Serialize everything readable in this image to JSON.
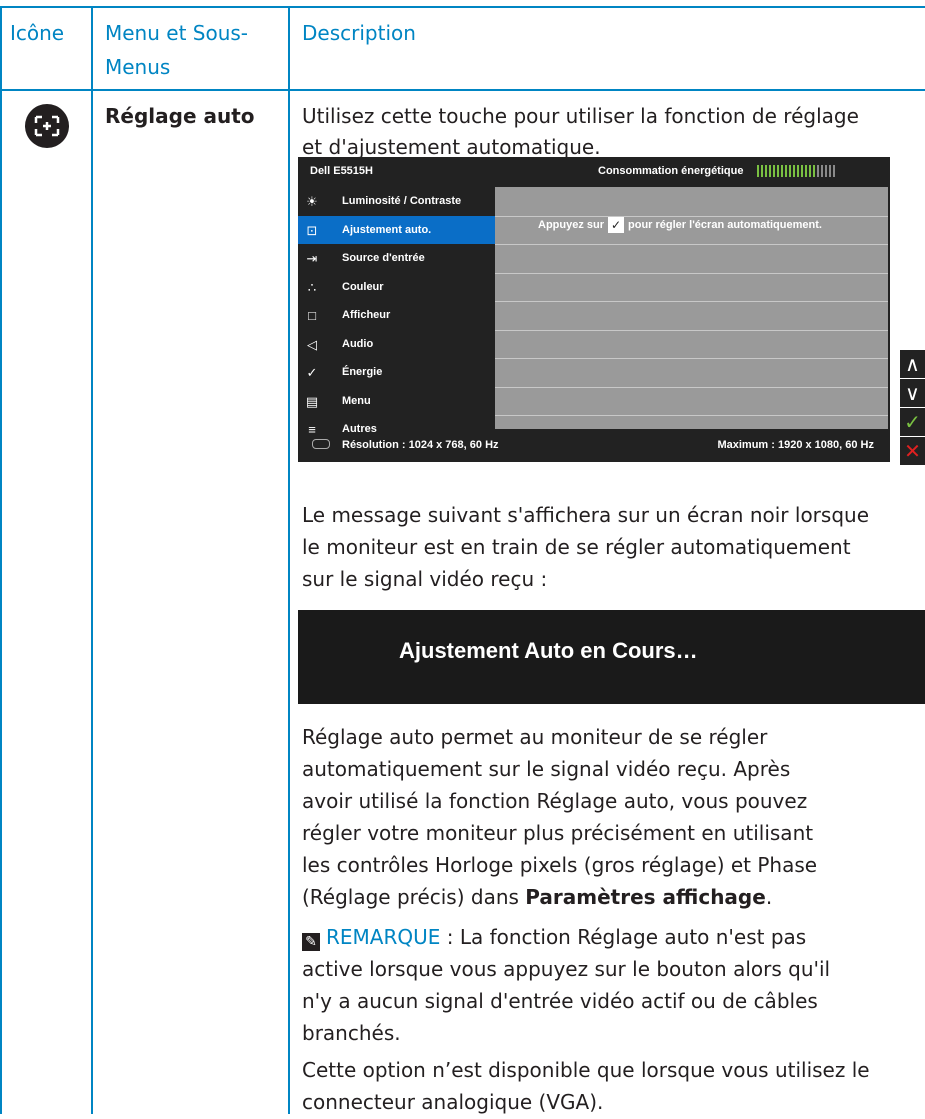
{
  "header": {
    "col1": "Icône",
    "col2a": "Menu et Sous-",
    "col2b": "Menus",
    "col3": "Description"
  },
  "row": {
    "icon_name": "auto-adjust-icon",
    "menu_label": "Réglage auto",
    "intro_line1": "Utilisez cette touche pour utiliser la fonction de réglage",
    "intro_line2": "et d'ajustement automatique.",
    "message_line1": "Le message suivant s'affichera sur un écran noir lorsque",
    "message_line2": "le moniteur est en train de se régler automatiquement",
    "message_line3": "sur le signal vidéo reçu :",
    "message_box_text": "Ajustement Auto en Cours…",
    "para_line1": "Réglage auto permet au moniteur de se régler",
    "para_line2": "automatiquement sur le signal vidéo reçu. Après",
    "para_line3": "avoir utilisé la fonction Réglage auto, vous pouvez",
    "para_line4": "régler votre moniteur plus précisément en utilisant",
    "para_line5": "les contrôles Horloge pixels (gros réglage) et Phase",
    "para_line6_pre": "(Réglage précis) dans ",
    "para_line6_bold": "Paramètres affichage",
    "para_line6_post": ".",
    "note_label": "REMARQUE",
    "note_line1_rest": " : La fonction Réglage auto n'est pas",
    "note_line2": "active lorsque vous appuyez sur le bouton alors qu'il",
    "note_line3": "n'y a aucun signal d'entrée vidéo actif ou de câbles",
    "note_line4": "branchés.",
    "vga_line1": "Cette option n’est disponible que lorsque vous utilisez le",
    "vga_line2": "connecteur analogique (VGA)."
  },
  "osd": {
    "model": "Dell E5515H",
    "energy_label": "Consommation énergétique",
    "energy_level_fraction": 0.75,
    "menu_items": [
      {
        "label": "Luminosité / Contraste",
        "icon": "brightness-icon",
        "glyph": "☀"
      },
      {
        "label": "Ajustement auto.",
        "icon": "auto-adjust-icon",
        "glyph": "⊡"
      },
      {
        "label": "Source d'entrée",
        "icon": "input-source-icon",
        "glyph": "⇥"
      },
      {
        "label": "Couleur",
        "icon": "color-icon",
        "glyph": "∴"
      },
      {
        "label": "Afficheur",
        "icon": "display-icon",
        "glyph": "□"
      },
      {
        "label": "Audio",
        "icon": "speaker-icon",
        "glyph": "◁"
      },
      {
        "label": "Énergie",
        "icon": "energy-leaf-icon",
        "glyph": "✓"
      },
      {
        "label": "Menu",
        "icon": "menu-icon",
        "glyph": "▤"
      },
      {
        "label": "Autres",
        "icon": "others-icon",
        "glyph": "≡"
      }
    ],
    "selected_index": 1,
    "panel_msg_pre": "Appuyez sur",
    "panel_msg_post": "pour régler l'écran automatiquement.",
    "resolution": "Résolution : 1024 x 768, 60 Hz",
    "maximum": "Maximum : 1920 x 1080, 60 Hz",
    "side_buttons": [
      {
        "icon": "chevron-up-icon",
        "glyph": "∧",
        "color": "#ffffff"
      },
      {
        "icon": "chevron-down-icon",
        "glyph": "∨",
        "color": "#ffffff"
      },
      {
        "icon": "check-icon",
        "glyph": "✓",
        "color": "#7ac142"
      },
      {
        "icon": "close-icon",
        "glyph": "✕",
        "color": "#e02020"
      }
    ]
  },
  "colors": {
    "accent": "#0085c3",
    "osd_bg": "#222222",
    "osd_selected": "#0a6ec7",
    "energy_green": "#7ac142"
  }
}
